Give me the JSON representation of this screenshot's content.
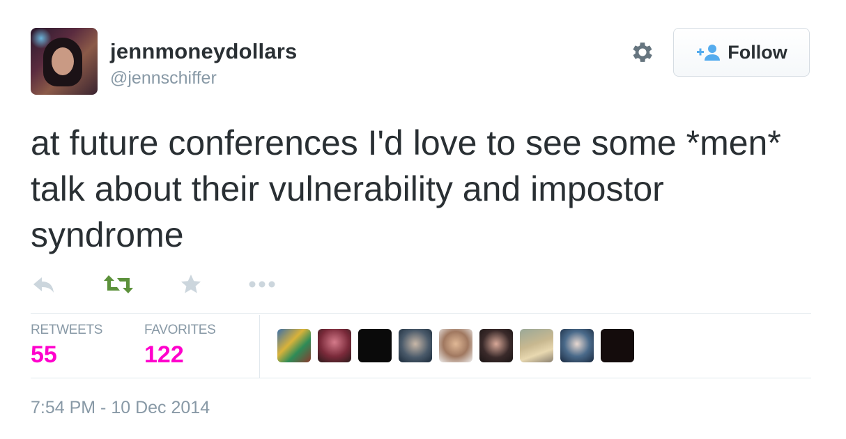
{
  "user": {
    "display_name": "jennmoneydollars",
    "screen_name": "@jennschiffer"
  },
  "follow_button": {
    "label": "Follow",
    "icon": "add-user-icon"
  },
  "settings": {
    "icon": "gear-icon"
  },
  "tweet": {
    "text": "at future conferences I'd love to see some *men* talk about their vulnerability and impostor syndrome"
  },
  "actions": [
    {
      "name": "reply",
      "icon": "reply-icon"
    },
    {
      "name": "retweet",
      "icon": "retweet-icon"
    },
    {
      "name": "favorite",
      "icon": "star-icon"
    },
    {
      "name": "more",
      "icon": "more-dots-icon"
    }
  ],
  "stats": {
    "retweets_label": "RETWEETS",
    "retweets_count": "55",
    "favorites_label": "FAVORITES",
    "favorites_count": "122"
  },
  "timestamp": "7:54 PM - 10 Dec 2014",
  "colors": {
    "text": "#292f33",
    "muted": "#8899a6",
    "accent_stats": "#ff00cc",
    "retweet_green": "#5c913b",
    "icon_gray": "#ccd6dd",
    "follow_icon_blue": "#55acee",
    "divider": "#e1e8ed"
  },
  "favoriters": [
    {
      "name": "favoriter-1"
    },
    {
      "name": "favoriter-2"
    },
    {
      "name": "favoriter-3"
    },
    {
      "name": "favoriter-4"
    },
    {
      "name": "favoriter-5"
    },
    {
      "name": "favoriter-6"
    },
    {
      "name": "favoriter-7"
    },
    {
      "name": "favoriter-8"
    },
    {
      "name": "favoriter-9"
    }
  ]
}
